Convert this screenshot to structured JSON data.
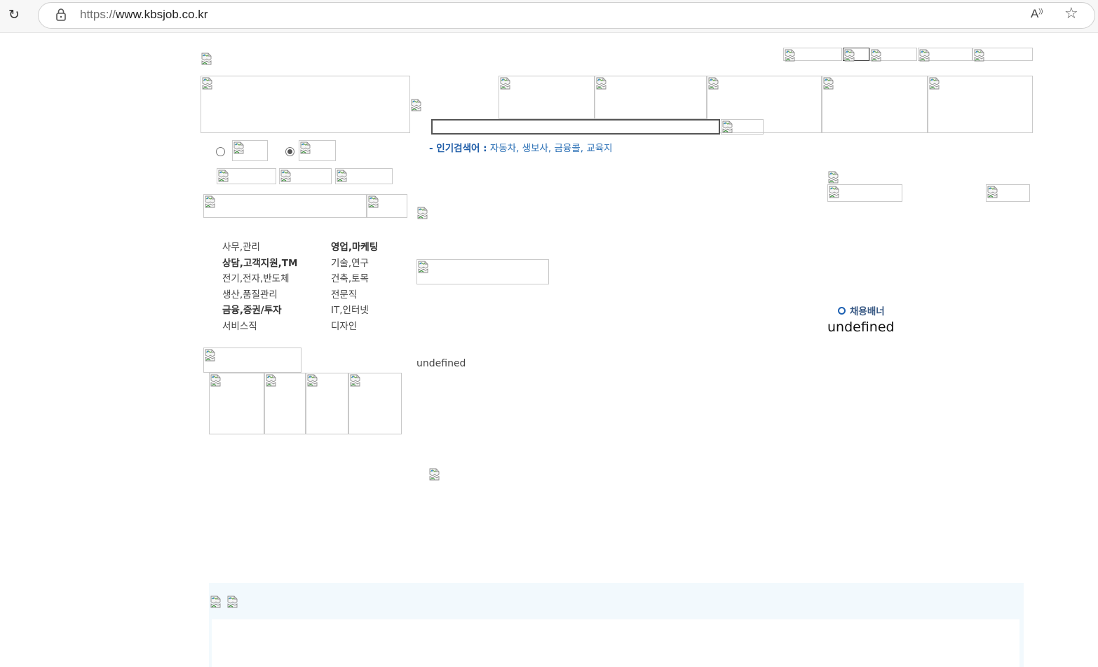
{
  "browser": {
    "url_protocol": "https://",
    "url_host": "www.kbsjob.co.kr",
    "read_aloud_label": "A",
    "read_aloud_sup": "))",
    "reload_glyph": "↻",
    "favorite_glyph": "☆"
  },
  "search": {
    "value": "",
    "hot_keywords_label": "- 인기검색어 :",
    "hot_keywords": "자동차, 생보사, 금융콜, 교육지"
  },
  "categories": {
    "left": [
      {
        "label": "사무,관리",
        "bold": false
      },
      {
        "label": "상담,고객지원,TM",
        "bold": true
      },
      {
        "label": "전기,전자,반도체",
        "bold": false
      },
      {
        "label": "생산,품질관리",
        "bold": false
      },
      {
        "label": "금융,증권/투자",
        "bold": true
      },
      {
        "label": "서비스직",
        "bold": false
      }
    ],
    "right": [
      {
        "label": "영업,마케팅",
        "bold": true
      },
      {
        "label": "기술,연구",
        "bold": false
      },
      {
        "label": "건축,토목",
        "bold": false
      },
      {
        "label": "전문직",
        "bold": false
      },
      {
        "label": "IT,인터넷",
        "bold": false
      },
      {
        "label": "디자인",
        "bold": false
      }
    ]
  },
  "main": {
    "undefined_text": "undefined"
  },
  "sidebar": {
    "banner_label": "채용배너",
    "undefined_text": "undefined"
  }
}
